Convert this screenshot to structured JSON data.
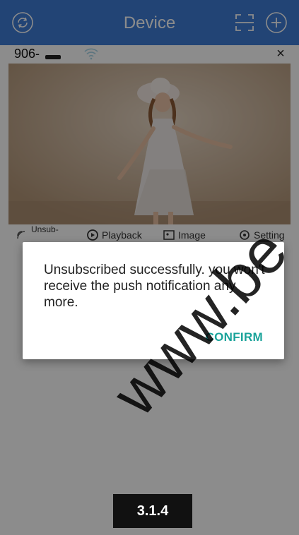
{
  "header": {
    "title": "Device",
    "left_icon": "refresh-icon",
    "scan_icon": "scan-qr-icon",
    "add_icon": "add-device-icon",
    "color": "#3f7cd6"
  },
  "device": {
    "name": "906-",
    "close_symbol": "×",
    "wifi_icon": "wifi-icon"
  },
  "actions": [
    {
      "label": "Unsub-",
      "icon": "unsubscribe-icon"
    },
    {
      "label": "Playback",
      "icon": "playback-icon"
    },
    {
      "label": "Image",
      "icon": "image-icon"
    },
    {
      "label": "Setting",
      "icon": "setting-icon"
    }
  ],
  "dialog": {
    "message": "Unsubscribed successfully. you won't receive the push notification any more.",
    "confirm_label": "CONFIRM",
    "confirm_color": "#1aa39a"
  },
  "version_tag": "3.1.4",
  "watermark": "www.be"
}
